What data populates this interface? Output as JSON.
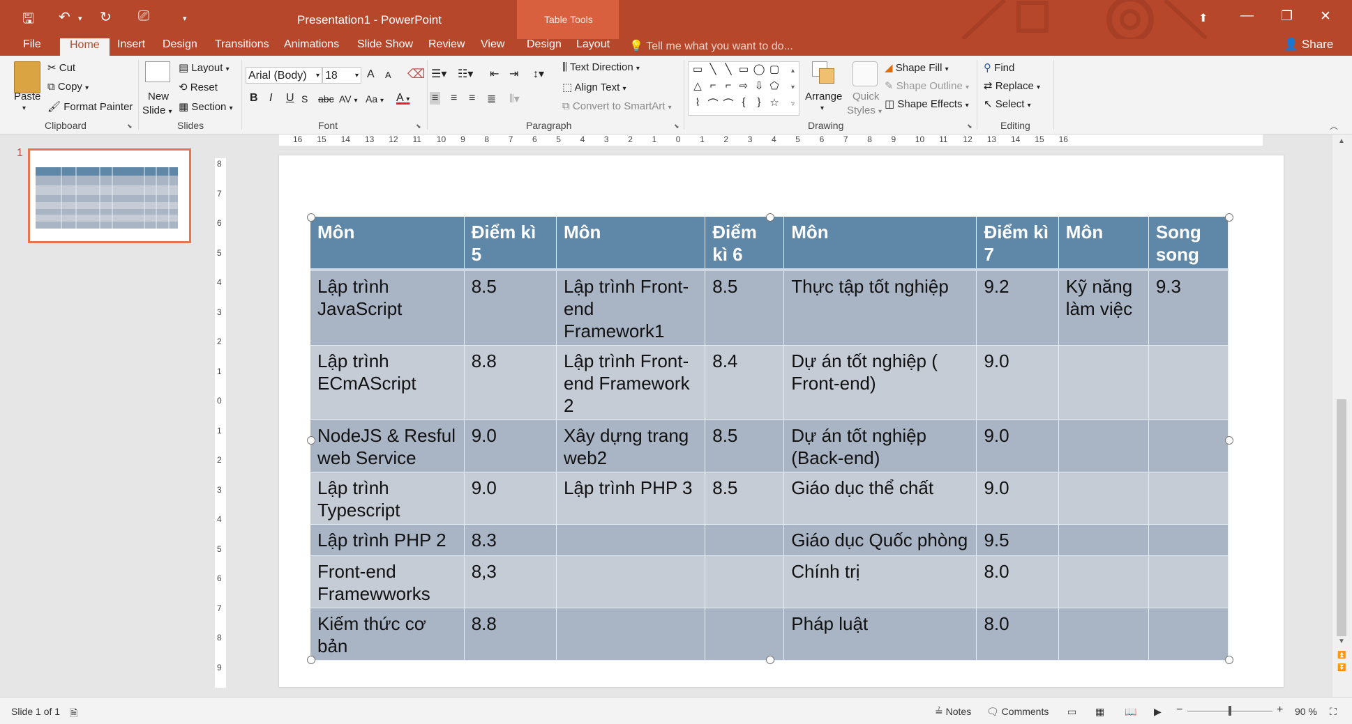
{
  "window": {
    "title": "Presentation1 - PowerPoint",
    "context_group": "Table Tools",
    "minimize_glyph": "—",
    "restore_glyph": "❐",
    "close_glyph": "✕",
    "ribbon_display_glyph": "⬆"
  },
  "quick_access": {
    "save": "save-icon",
    "undo": "undo-icon",
    "redo": "redo-icon",
    "present": "start-from-beginning-icon",
    "customize": "customize-icon"
  },
  "tabs": [
    "File",
    "Home",
    "Insert",
    "Design",
    "Transitions",
    "Animations",
    "Slide Show",
    "Review",
    "View",
    "Design",
    "Layout"
  ],
  "active_tab": "Home",
  "tell_me": "Tell me what you want to do...",
  "share": "Share",
  "ribbon": {
    "clipboard": {
      "label": "Clipboard",
      "paste": "Paste",
      "cut": "Cut",
      "copy": "Copy",
      "format_painter": "Format Painter"
    },
    "slides": {
      "label": "Slides",
      "new_slide_1": "New",
      "new_slide_2": "Slide",
      "layout": "Layout",
      "reset": "Reset",
      "section": "Section"
    },
    "font": {
      "label": "Font",
      "font_name": "Arial (Body)",
      "font_size": "18",
      "bold": "B",
      "italic": "I",
      "underline": "U",
      "strike": "abc",
      "spacing": "AV",
      "case": "Aa",
      "color": "A",
      "grow": "A",
      "shrink": "A"
    },
    "paragraph": {
      "label": "Paragraph",
      "text_direction": "Text Direction",
      "align_text": "Align Text",
      "convert": "Convert to SmartArt"
    },
    "drawing": {
      "label": "Drawing",
      "arrange": "Arrange",
      "quick_styles_1": "Quick",
      "quick_styles_2": "Styles",
      "shape_fill": "Shape Fill",
      "shape_outline": "Shape Outline",
      "shape_effects": "Shape Effects",
      "shapes": [
        "▭",
        "╲",
        "╲",
        "▭",
        "◯",
        "▢",
        "△",
        "⌐",
        "⌐",
        "⇨",
        "⇩",
        "⬠",
        "⌇",
        "⌒",
        "⌒",
        "{",
        "}",
        "☆"
      ]
    },
    "editing": {
      "label": "Editing",
      "find": "Find",
      "replace": "Replace",
      "select": "Select"
    }
  },
  "slide_pane": {
    "number": "1"
  },
  "rulers": {
    "horizontal": [
      "16",
      "15",
      "14",
      "13",
      "12",
      "11",
      "10",
      "9",
      "8",
      "7",
      "6",
      "5",
      "4",
      "3",
      "2",
      "1",
      "0",
      "1",
      "2",
      "3",
      "4",
      "5",
      "6",
      "7",
      "8",
      "9",
      "10",
      "11",
      "12",
      "13",
      "14",
      "15",
      "16"
    ],
    "vertical": [
      "8",
      "7",
      "6",
      "5",
      "4",
      "3",
      "2",
      "1",
      "0",
      "1",
      "2",
      "3",
      "4",
      "5",
      "6",
      "7",
      "8",
      "9"
    ]
  },
  "table": {
    "headers": [
      "Môn",
      "Điểm kì 5",
      "Môn",
      "Điểm kì 6",
      "Môn",
      "Điểm kì 7",
      "Môn",
      "Song song"
    ],
    "rows": [
      [
        "Lập trình JavaScript",
        "8.5",
        "Lập trình Front-end Framework1",
        "8.5",
        "Thực tập tốt nghiệp",
        "9.2",
        "Kỹ năng làm việc",
        "9.3"
      ],
      [
        "Lập trình ECmAScript",
        "8.8",
        "Lập trình Front-end Framework 2",
        "8.4",
        "Dự án tốt nghiệp ( Front-end)",
        "9.0",
        "",
        ""
      ],
      [
        "NodeJS & Resful web Service",
        "9.0",
        "Xây dựng trang web2",
        "8.5",
        "Dự án tốt nghiệp (Back-end)",
        "9.0",
        "",
        ""
      ],
      [
        "Lập trình Typescript",
        "9.0",
        "Lập trình PHP 3",
        "8.5",
        "Giáo dục thể chất",
        "9.0",
        "",
        ""
      ],
      [
        "Lập trình PHP 2",
        "8.3",
        "",
        "",
        "Giáo dục Quốc phòng",
        "9.5",
        "",
        ""
      ],
      [
        "Front-end Framewworks",
        "8,3",
        "",
        "",
        "Chính trị",
        "8.0",
        "",
        ""
      ],
      [
        "Kiếm thức cơ bản",
        "8.8",
        "",
        "",
        "Pháp luật",
        "8.0",
        "",
        ""
      ]
    ]
  },
  "status": {
    "slide_of": "Slide 1 of 1",
    "notes": "Notes",
    "comments": "Comments",
    "zoom": "90 %",
    "zoom_level": 0.5
  },
  "colors": {
    "accent": "#b7472a",
    "header_fill": "#5f87a8",
    "row_dark": "#a9b5c4",
    "row_light": "#c5ccd6"
  }
}
